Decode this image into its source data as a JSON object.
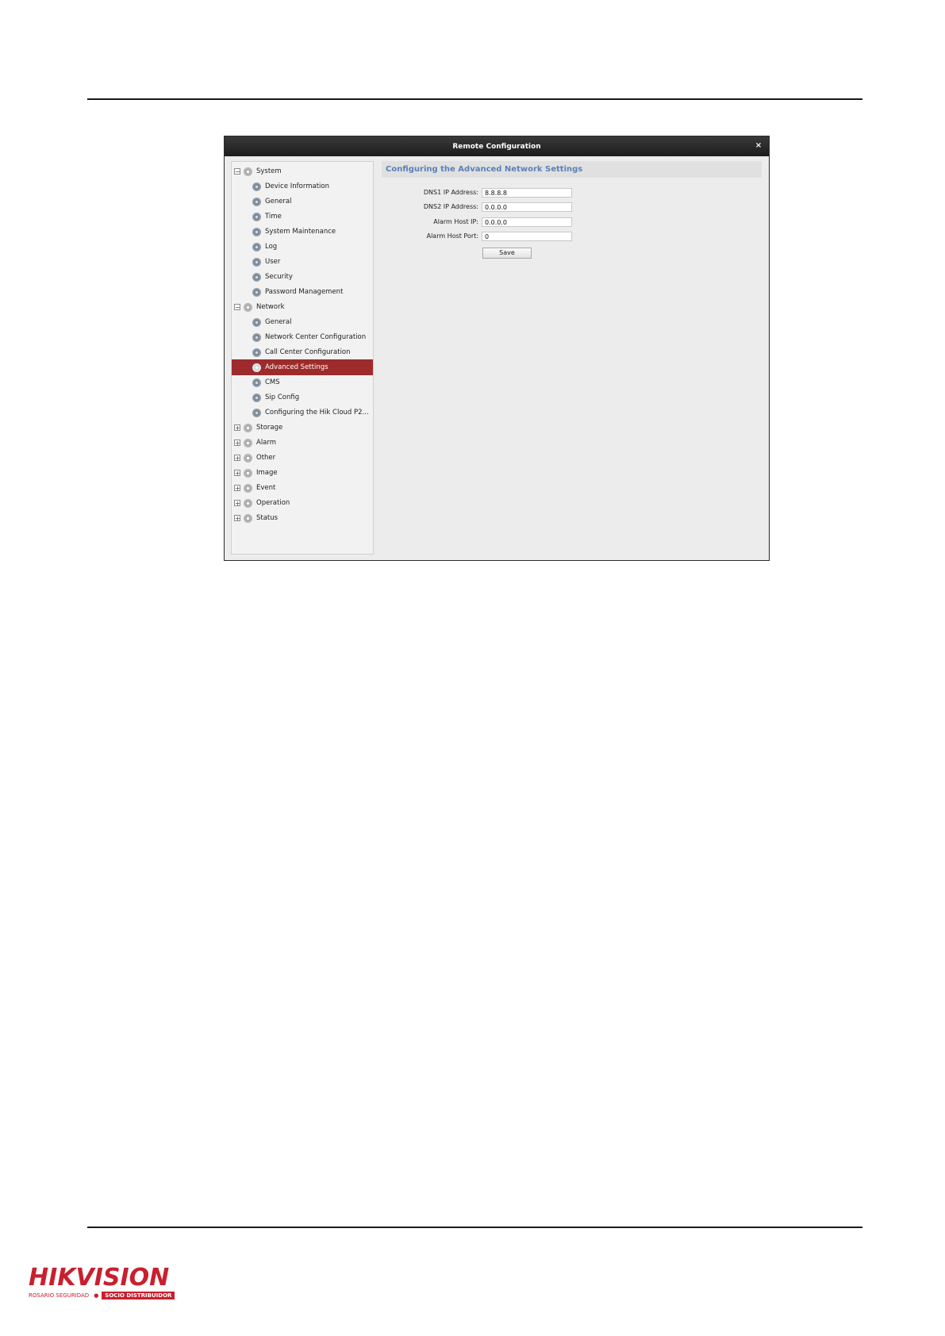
{
  "window": {
    "title": "Remote Configuration",
    "close_glyph": "×"
  },
  "tree": {
    "system": {
      "label": "System",
      "expander": "−",
      "children": [
        "Device Information",
        "General",
        "Time",
        "System Maintenance",
        "Log",
        "User",
        "Security",
        "Password Management"
      ]
    },
    "network": {
      "label": "Network",
      "expander": "−",
      "children": [
        "General",
        "Network Center Configuration",
        "Call Center Configuration",
        "Advanced Settings",
        "CMS",
        "Sip Config",
        "Configuring the Hik Cloud P2..."
      ],
      "selected_child": "Advanced Settings"
    },
    "collapsed": [
      {
        "label": "Storage",
        "expander": "+"
      },
      {
        "label": "Alarm",
        "expander": "+"
      },
      {
        "label": "Other",
        "expander": "+"
      },
      {
        "label": "Image",
        "expander": "+"
      },
      {
        "label": "Event",
        "expander": "+"
      },
      {
        "label": "Operation",
        "expander": "+"
      },
      {
        "label": "Status",
        "expander": "+"
      }
    ]
  },
  "content": {
    "header": "Configuring the Advanced Network Settings",
    "fields": [
      {
        "label": "DNS1 IP Address:",
        "value": "8.8.8.8"
      },
      {
        "label": "DNS2 IP Address:",
        "value": "0.0.0.0"
      },
      {
        "label": "Alarm Host IP:",
        "value": "0.0.0.0"
      },
      {
        "label": "Alarm Host Port:",
        "value": "0"
      }
    ],
    "save_label": "Save"
  },
  "logo": {
    "brand": "HIKVISION",
    "left_tag": "ROSARIO SEGURIDAD",
    "dot": "●",
    "right_tag": "SOCIO DISTRIBUIDOR"
  },
  "colors": {
    "selected_row": "#9e2b2b",
    "header_text": "#5b80b8",
    "brand_red": "#c8202e"
  },
  "icons": {
    "group": "gear-group-icon",
    "item": "gear-icon",
    "close": "close-icon"
  }
}
